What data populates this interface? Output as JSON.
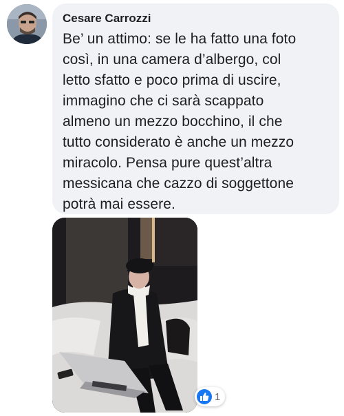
{
  "comment": {
    "author": "Cesare Carrozzi",
    "text": "Be’ un attimo: se le ha fatto una foto\ncosì, in una camera d’albergo, col\nletto sfatto e poco prima di uscire,\nimmagino che ci sarà scappato\nalmeno un mezzo bocchino, il che\ntutto considerato è anche un mezzo\nmiracolo. Pensa pure quest’altra\nmessicana che cazzo di soggettone\npotrà mai essere.",
    "reaction_icon": "like-icon",
    "reaction_count": "1"
  },
  "colors": {
    "bubble": "#f0f2f5",
    "like_blue": "#1877f2",
    "text": "#1c1e21"
  }
}
